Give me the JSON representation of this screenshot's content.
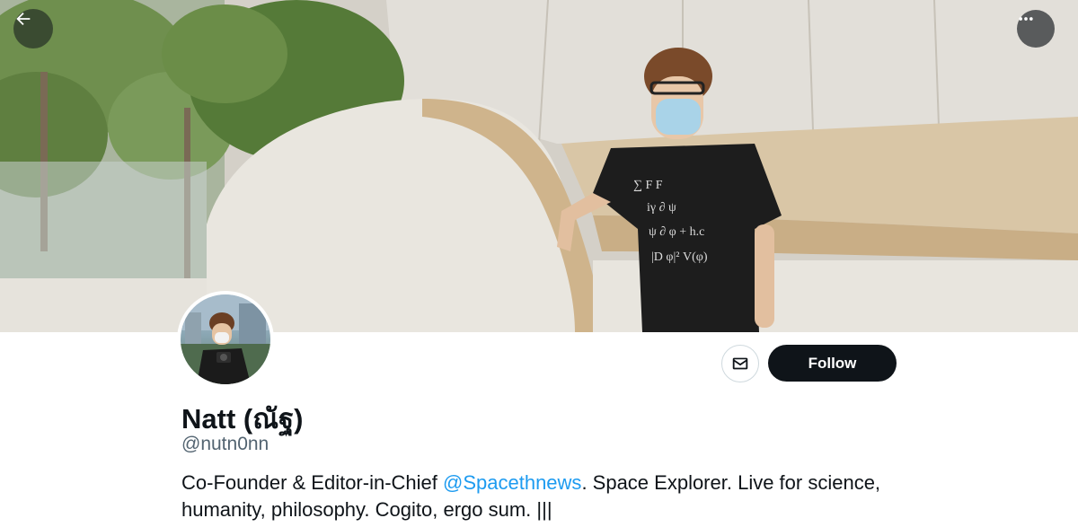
{
  "header": {
    "back_icon": "arrow-left-icon",
    "more_icon": "ellipsis-icon"
  },
  "profile": {
    "display_name": "Natt (ณัฐ)",
    "handle": "@nutn0nn",
    "bio": {
      "before_mention": "Co-Founder & Editor-in-Chief ",
      "mention": "@Spacethnews",
      "after_mention": ". Space Explorer. Live for science, humanity, philosophy. Cogito, ergo sum. |||"
    }
  },
  "actions": {
    "message_icon": "envelope-icon",
    "follow_label": "Follow"
  },
  "colors": {
    "accent": "#1d9bf0",
    "follow_bg": "#0f1419",
    "secondary_text": "#536471"
  }
}
